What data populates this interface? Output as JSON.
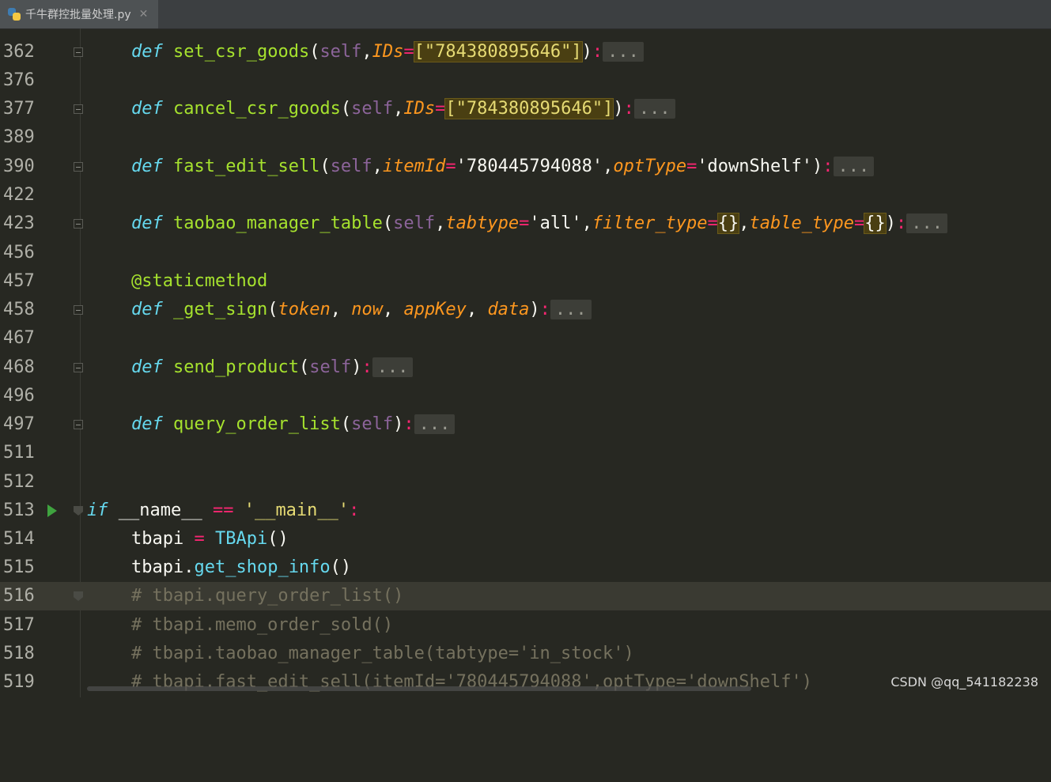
{
  "tab": {
    "title": "千牛群控批量处理.py",
    "close": "✕"
  },
  "lines": [
    {
      "num": "362",
      "fold": "open",
      "current": false
    },
    {
      "num": "376"
    },
    {
      "num": "377",
      "fold": "open"
    },
    {
      "num": "389"
    },
    {
      "num": "390",
      "fold": "open"
    },
    {
      "num": "422"
    },
    {
      "num": "423",
      "fold": "open"
    },
    {
      "num": "456"
    },
    {
      "num": "457"
    },
    {
      "num": "458",
      "fold": "open"
    },
    {
      "num": "467"
    },
    {
      "num": "468",
      "fold": "open"
    },
    {
      "num": "496"
    },
    {
      "num": "497",
      "fold": "open"
    },
    {
      "num": "511"
    },
    {
      "num": "512"
    },
    {
      "num": "513",
      "run": true,
      "fold": "end"
    },
    {
      "num": "514"
    },
    {
      "num": "515"
    },
    {
      "num": "516",
      "current": true,
      "fold": "end"
    },
    {
      "num": "517"
    },
    {
      "num": "518"
    },
    {
      "num": "519"
    }
  ],
  "code": {
    "l362": {
      "def": "def",
      "name": "set_csr_goods",
      "p1": "(",
      "self": "self",
      "c1": ",",
      "param": "IDs",
      "eq": "=",
      "val": "[\"784380895646\"]",
      "p2": ")",
      "colon": ":",
      "dots": "..."
    },
    "l377": {
      "def": "def",
      "name": "cancel_csr_goods",
      "p1": "(",
      "self": "self",
      "c1": ",",
      "param": "IDs",
      "eq": "=",
      "val": "[\"784380895646\"]",
      "p2": ")",
      "colon": ":",
      "dots": "..."
    },
    "l390": {
      "def": "def",
      "name": "fast_edit_sell",
      "p1": "(",
      "self": "self",
      "c1": ",",
      "param1": "itemId",
      "eq": "=",
      "val1": "'780445794088'",
      "c2": ",",
      "param2": "optType",
      "val2": "'downShelf'",
      "p2": ")",
      "colon": ":",
      "dots": "..."
    },
    "l423": {
      "def": "def",
      "name": "taobao_manager_table",
      "p1": "(",
      "self": "self",
      "c1": ",",
      "param1": "tabtype",
      "eq": "=",
      "val1": "'all'",
      "c2": ",",
      "param2": "filter_type",
      "val2": "{}",
      "c3": ",",
      "param3": "table_type",
      "val3": "{}",
      "p2": ")",
      "colon": ":",
      "dots": "..."
    },
    "l457": {
      "deco": "@staticmethod"
    },
    "l458": {
      "def": "def",
      "name": "_get_sign",
      "p1": "(",
      "param1": "token",
      "c1": ", ",
      "param2": "now",
      "param3": "appKey",
      "param4": "data",
      "p2": ")",
      "colon": ":",
      "dots": "..."
    },
    "l468": {
      "def": "def",
      "name": "send_product",
      "p1": "(",
      "self": "self",
      "p2": ")",
      "colon": ":",
      "dots": "..."
    },
    "l497": {
      "def": "def",
      "name": "query_order_list",
      "p1": "(",
      "self": "self",
      "p2": ")",
      "colon": ":",
      "dots": "..."
    },
    "l513": {
      "kw": "if",
      "a": " __name__ ",
      "op": "==",
      "str": "'__main__'",
      "colon": ":"
    },
    "l514": {
      "var": "tbapi",
      "op": "=",
      "cls": "TBApi",
      "parens": "()"
    },
    "l515": {
      "var": "tbapi",
      "dot": ".",
      "call": "get_shop_info",
      "parens": "()"
    },
    "l516": {
      "text": "# tbapi.query_order_list()"
    },
    "l517": {
      "text": "# tbapi.memo_order_sold()"
    },
    "l518": {
      "text": "# tbapi.taobao_manager_table(tabtype='in_stock')"
    },
    "l519": {
      "text": "# tbapi.fast_edit_sell(itemId='780445794088',optType='downShelf')"
    }
  },
  "watermark": "CSDN @qq_541182238",
  "colors": {
    "background": "#272822",
    "keyword": "#66d9ef",
    "function": "#a6e22e",
    "param": "#fd971f",
    "string": "#e6db74",
    "operator": "#f92672",
    "comment": "#75715e"
  }
}
